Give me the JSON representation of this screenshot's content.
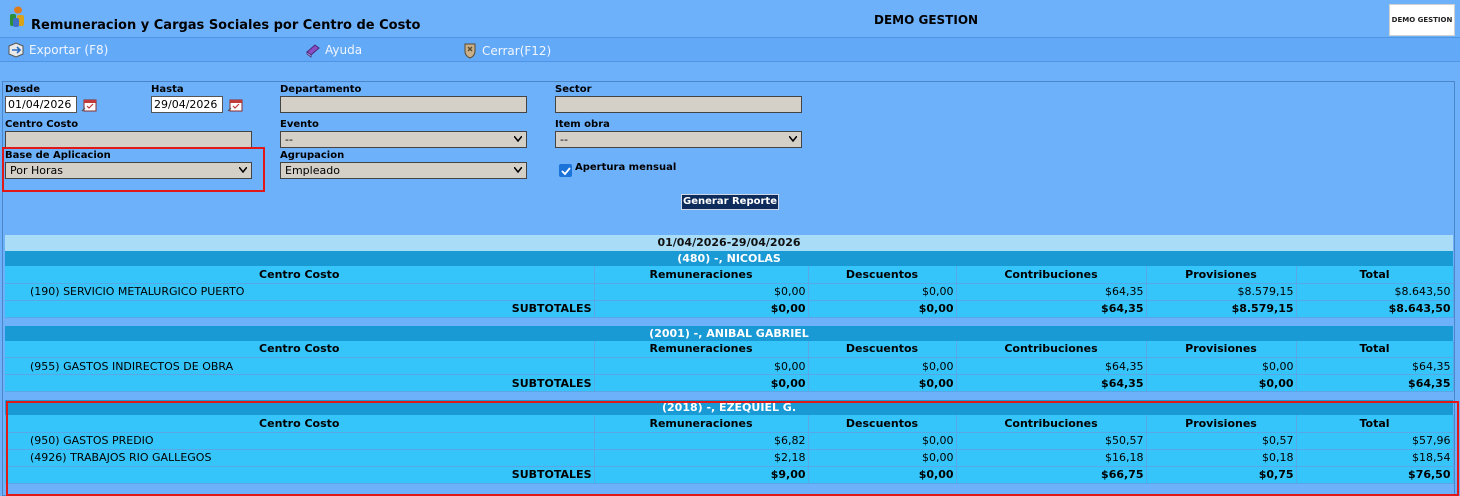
{
  "window": {
    "title": "Remuneracion y Cargas Sociales por Centro de Costo",
    "company": "DEMO GESTION",
    "brand_label": "DEMO GESTION"
  },
  "toolbar": {
    "export_label": "Exportar (F8)",
    "help_label": "Ayuda",
    "close_label": "Cerrar(F12)"
  },
  "filters": {
    "desde_label": "Desde",
    "desde_value": "01/04/2026",
    "hasta_label": "Hasta",
    "hasta_value": "29/04/2026",
    "departamento_label": "Departamento",
    "sector_label": "Sector",
    "centro_costo_label": "Centro Costo",
    "evento_label": "Evento",
    "evento_value": "--",
    "item_obra_label": "Item obra",
    "item_obra_value": "--",
    "base_label": "Base de Aplicacion",
    "base_value": "Por Horas",
    "agrupacion_label": "Agrupacion",
    "agrupacion_value": "Empleado",
    "apertura_label": "Apertura mensual",
    "apertura_checked": true,
    "generate_label": "Generar Reporte"
  },
  "report": {
    "date_range": "01/04/2026-29/04/2026",
    "columns": [
      "Centro Costo",
      "Remuneraciones",
      "Descuentos",
      "Contribuciones",
      "Provisiones",
      "Total"
    ],
    "subtotal_label": "SUBTOTALES",
    "groups": [
      {
        "title": "(480) -, NICOLAS",
        "rows": [
          {
            "cc": "(190) SERVICIO METALURGICO PUERTO",
            "rem": "$0,00",
            "desc": "$0,00",
            "contrib": "$64,35",
            "prov": "$8.579,15",
            "total": "$8.643,50"
          }
        ],
        "subtotal": {
          "rem": "$0,00",
          "desc": "$0,00",
          "contrib": "$64,35",
          "prov": "$8.579,15",
          "total": "$8.643,50"
        }
      },
      {
        "title": "(2001) -, ANIBAL GABRIEL",
        "rows": [
          {
            "cc": "(955) GASTOS INDIRECTOS DE OBRA",
            "rem": "$0,00",
            "desc": "$0,00",
            "contrib": "$64,35",
            "prov": "$0,00",
            "total": "$64,35"
          }
        ],
        "subtotal": {
          "rem": "$0,00",
          "desc": "$0,00",
          "contrib": "$64,35",
          "prov": "$0,00",
          "total": "$64,35"
        }
      },
      {
        "title": "(2018) -, EZEQUIEL G.",
        "rows": [
          {
            "cc": "(950) GASTOS PREDIO",
            "rem": "$6,82",
            "desc": "$0,00",
            "contrib": "$50,57",
            "prov": "$0,57",
            "total": "$57,96"
          },
          {
            "cc": "(4926) TRABAJOS RIO GALLEGOS",
            "rem": "$2,18",
            "desc": "$0,00",
            "contrib": "$16,18",
            "prov": "$0,18",
            "total": "$18,54"
          }
        ],
        "subtotal": {
          "rem": "$9,00",
          "desc": "$0,00",
          "contrib": "$66,75",
          "prov": "$0,75",
          "total": "$76,50"
        }
      }
    ]
  },
  "colors": {
    "background": "#6eb1fb",
    "table_cell": "#35c5fb",
    "group_header": "#1a9ad5",
    "highlight": "#e01818",
    "button": "#0d2c5b"
  }
}
